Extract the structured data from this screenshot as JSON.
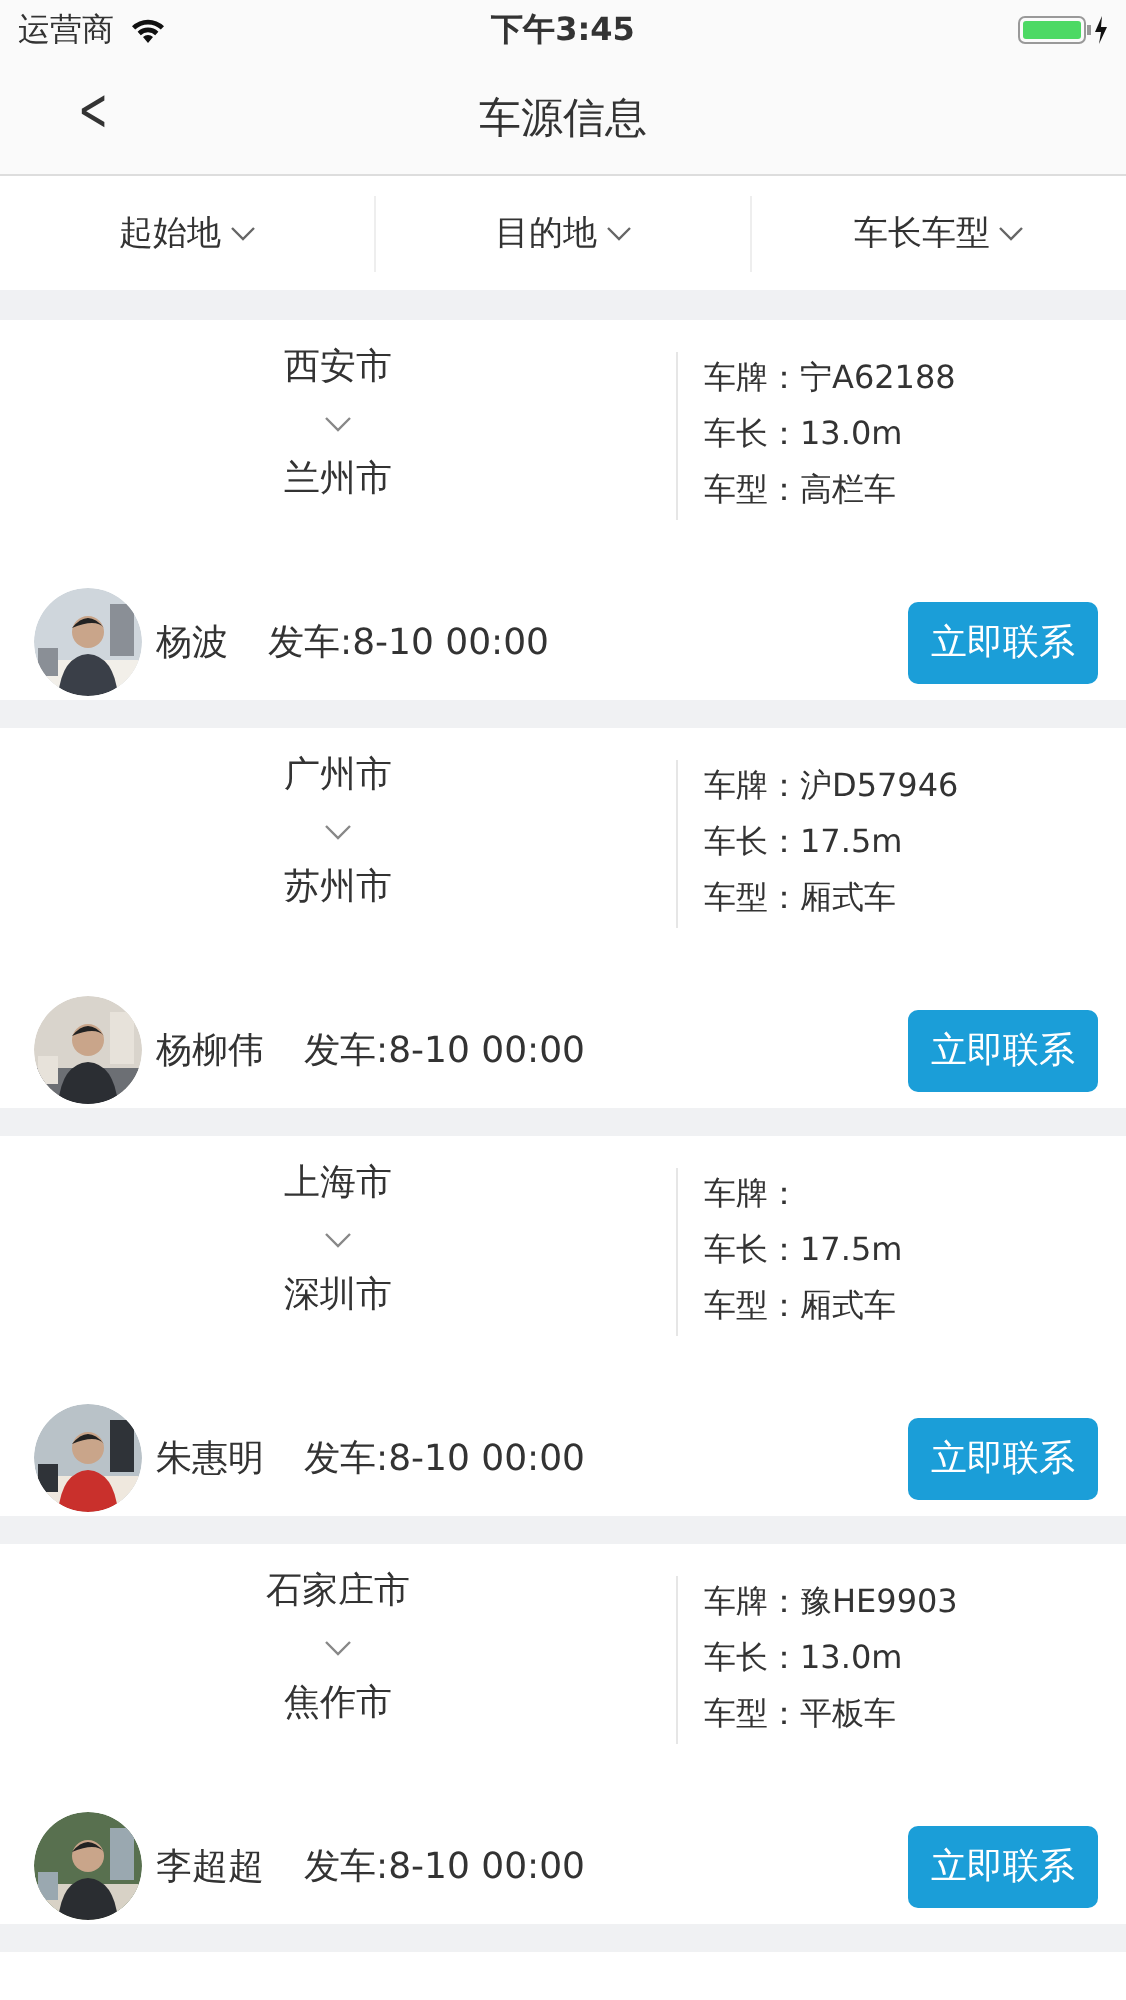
{
  "status_bar": {
    "carrier": "运营商",
    "time": "下午3:45"
  },
  "nav_bar": {
    "back": "<",
    "title": "车源信息"
  },
  "filters": [
    {
      "label": "起始地"
    },
    {
      "label": "目的地"
    },
    {
      "label": "车长车型"
    }
  ],
  "listings": [
    {
      "from": "西安市",
      "to": "兰州市",
      "info": [
        {
          "label": "车牌：",
          "value": "宁A62188"
        },
        {
          "label": "车长：",
          "value": "13.0m"
        },
        {
          "label": "车型：",
          "value": "高栏车"
        }
      ],
      "driver": "杨波",
      "departure": "发车:8-10 00:00",
      "button": "立即联系",
      "avatar": {
        "kind": "picture"
      }
    },
    {
      "from": "广州市",
      "to": "苏州市",
      "info": [
        {
          "label": "车牌：",
          "value": "沪D57946"
        },
        {
          "label": "车长：",
          "value": "17.5m"
        },
        {
          "label": "车型：",
          "value": "厢式车"
        }
      ],
      "driver": "杨柳伟",
      "departure": "发车:8-10 00:00",
      "button": "立即联系",
      "avatar": {
        "kind": "picture"
      }
    },
    {
      "from": "上海市",
      "to": "深圳市",
      "info": [
        {
          "label": "车牌："
        },
        {
          "label": "车长：",
          "value": "17.5m"
        },
        {
          "label": "车型：",
          "value": "厢式车"
        }
      ],
      "driver": "朱惠明",
      "departure": "发车:8-10 00:00",
      "button": "立即联系",
      "avatar": {
        "kind": "picture"
      }
    },
    {
      "from": "石家庄市",
      "to": "焦作市",
      "info": [
        {
          "label": "车牌：",
          "value": "豫HE9903"
        },
        {
          "label": "车长：",
          "value": "13.0m"
        },
        {
          "label": "车型：",
          "value": "平板车"
        }
      ],
      "driver": "李超超",
      "departure": "发车:8-10 00:00",
      "button": "立即联系",
      "avatar": {
        "kind": "picture"
      }
    }
  ]
}
